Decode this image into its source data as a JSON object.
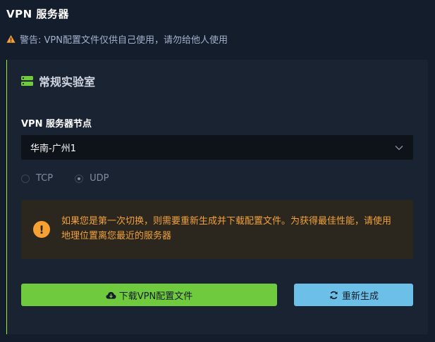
{
  "header": {
    "title": "VPN  服务器",
    "warning": "警告: VPN配置文件仅供自己使用，请勿给他人使用"
  },
  "card": {
    "title": "常规实验室",
    "server_label": "VPN 服务器节点",
    "server_selected": "华南-广州1",
    "protocols": [
      {
        "label": "TCP",
        "selected": false
      },
      {
        "label": "UDP",
        "selected": true
      }
    ],
    "notice": "如果您是第一次切换，则需要重新生成并下载配置文件。为获得最佳性能，请使用地理位置离您最近的服务器",
    "notice_icon": "!",
    "download_label": "下载VPN配置文件",
    "regenerate_label": "重新生成"
  },
  "colors": {
    "background": "#141d2b",
    "card": "#1a2332",
    "accent_green": "#9fef00",
    "warning_orange": "#f7a133",
    "download_button": "#6fca3e",
    "regenerate_button": "#6cbfe6"
  },
  "icons": [
    "warning-icon",
    "server-icon",
    "chevron-down-icon",
    "exclamation-icon",
    "cloud-download-icon",
    "refresh-icon"
  ]
}
